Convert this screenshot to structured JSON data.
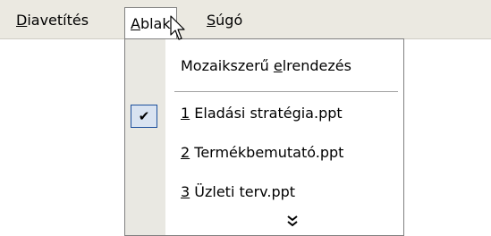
{
  "menubar": {
    "items": [
      {
        "label": "Diavetítés"
      },
      {
        "label": "Ablak"
      },
      {
        "label": "Súgó"
      }
    ]
  },
  "dropdown": {
    "items": [
      {
        "label": "Mozaikszerű elrendezés"
      },
      {
        "label": "1 Eladási stratégia.ppt",
        "checked": true
      },
      {
        "label": "2 Termékbemutató.ppt"
      },
      {
        "label": "3 Üzleti terv.ppt"
      }
    ],
    "checkmark": "✔",
    "more_icon": "chevron-double-down-icon",
    "more_glyph": "»"
  }
}
